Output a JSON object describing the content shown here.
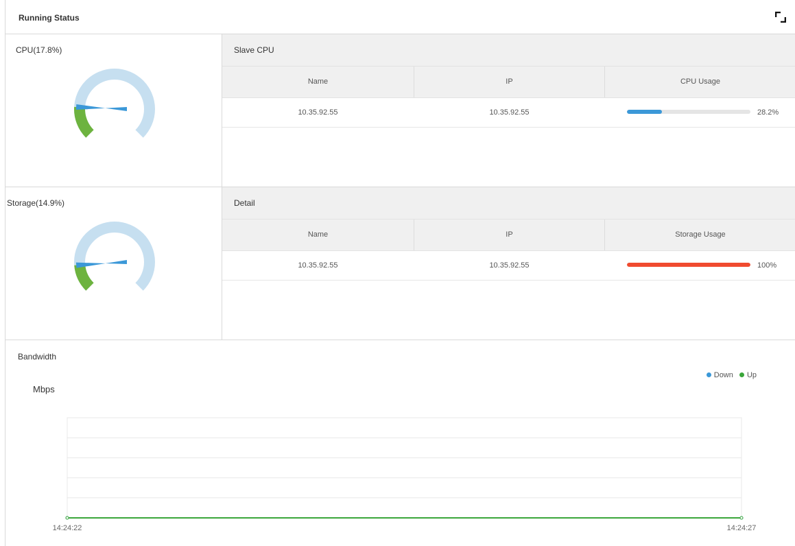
{
  "header": {
    "title": "Running Status",
    "fullscreen_icon": "fullscreen-icon"
  },
  "cpu": {
    "label": "CPU(17.8%)",
    "value_percent": 17.8,
    "gauge_colors": {
      "track": "#c6dff0",
      "fill": "#6db33f",
      "needle": "#3b98d8"
    }
  },
  "slave_cpu": {
    "title": "Slave CPU",
    "columns": [
      "Name",
      "IP",
      "CPU Usage"
    ],
    "rows": [
      {
        "name": "10.35.92.55",
        "ip": "10.35.92.55",
        "usage_label": "28.2%",
        "usage": 28.2,
        "bar_color": "#3b98d8"
      }
    ]
  },
  "storage": {
    "label": "Storage(14.9%)",
    "value_percent": 14.9
  },
  "detail": {
    "title": "Detail",
    "columns": [
      "Name",
      "IP",
      "Storage Usage"
    ],
    "rows": [
      {
        "name": "10.35.92.55",
        "ip": "10.35.92.55",
        "usage_label": "100%",
        "usage": 100,
        "bar_color": "#f04b2f"
      }
    ]
  },
  "bandwidth": {
    "title": "Bandwidth",
    "legend": [
      {
        "name": "Down",
        "color": "#3b98d8"
      },
      {
        "name": "Up",
        "color": "#3aa63a"
      }
    ]
  },
  "chart_data": {
    "type": "line",
    "title": "Bandwidth",
    "ylabel": "Mbps",
    "x": [
      "14:24:22",
      "14:24:27"
    ],
    "series": [
      {
        "name": "Down",
        "values": [
          0,
          0
        ],
        "color": "#3b98d8"
      },
      {
        "name": "Up",
        "values": [
          0,
          0
        ],
        "color": "#3aa63a"
      }
    ],
    "grid": true,
    "legend_position": "top-right"
  }
}
